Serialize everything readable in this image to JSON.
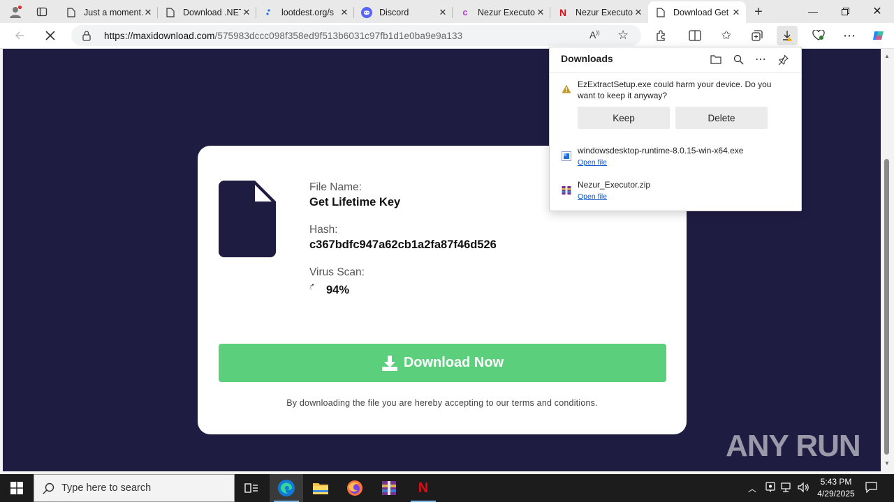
{
  "tabs": [
    {
      "title": "Just a moment...",
      "favicon": "page-icon"
    },
    {
      "title": "Download .NET",
      "favicon": "page-icon"
    },
    {
      "title": "lootdest.org/s",
      "favicon": "lootdest-icon"
    },
    {
      "title": "Discord",
      "favicon": "discord-icon"
    },
    {
      "title": "Nezur Executor",
      "favicon": "nezur-icon"
    },
    {
      "title": "Nezur Executor",
      "favicon": "netflix-n-icon"
    },
    {
      "title": "Download Get Lifetime Key",
      "favicon": "page-icon",
      "active": true
    }
  ],
  "address": {
    "host": "https://maxidownload.com",
    "path": "/575983dccc098f358ed9f513b6031c97fb1d1e0ba9e9a133"
  },
  "file": {
    "name_label": "File Name:",
    "name": "Get Lifetime Key",
    "hash_label": "Hash:",
    "hash": "c367bdfc947a62cb1a2fa87f46d526",
    "scan_label": "Virus Scan:",
    "scan_progress": "94%"
  },
  "download_button": "Download Now",
  "terms": "By downloading the file you are hereby accepting to our terms and conditions.",
  "watermark": "ANY RUN",
  "downloads": {
    "title": "Downloads",
    "warning": "EzExtractSetup.exe could harm your device. Do you want to keep it anyway?",
    "keep": "Keep",
    "delete": "Delete",
    "items": [
      {
        "name": "windowsdesktop-runtime-8.0.15-win-x64.exe",
        "link": "Open file"
      },
      {
        "name": "Nezur_Executor.zip",
        "link": "Open file"
      }
    ]
  },
  "taskbar": {
    "search_placeholder": "Type here to search",
    "time": "5:43 PM",
    "date": "4/29/2025"
  },
  "colors": {
    "page_bg": "#1f1c42",
    "download_green": "#5ccf7d",
    "link_blue": "#0b57d0",
    "taskbar": "#1c1c1c"
  }
}
